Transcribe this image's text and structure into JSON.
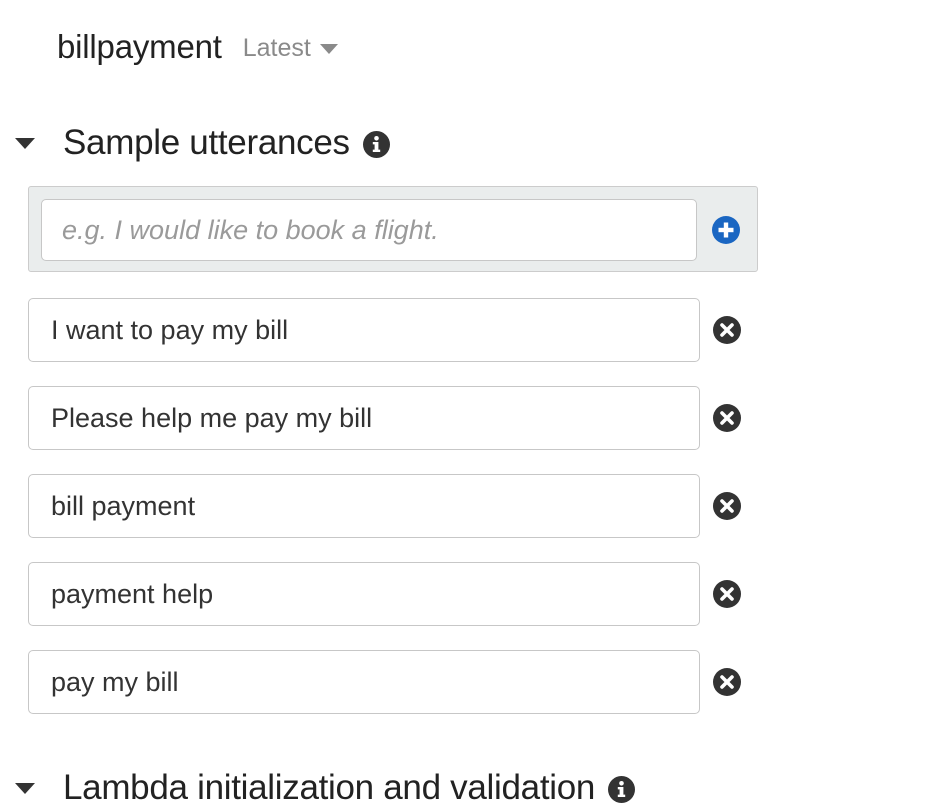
{
  "intent": {
    "name": "billpayment",
    "version_label": "Latest"
  },
  "sample_utterances": {
    "title": "Sample utterances",
    "new_placeholder": "e.g. I would like to book a flight.",
    "items": [
      "I want to pay my bill",
      "Please help me pay my bill",
      "bill payment",
      "payment help",
      "pay my bill"
    ]
  },
  "lambda_section": {
    "title": "Lambda initialization and validation"
  },
  "colors": {
    "accent_blue": "#1a66c2",
    "icon_dark": "#333333",
    "muted_gray": "#8a8a8a"
  },
  "icons": {
    "section_toggle": "caret-down-icon",
    "info": "info-icon",
    "add": "plus-circle-icon",
    "remove": "x-circle-icon",
    "version_dropdown": "chevron-down-icon"
  }
}
